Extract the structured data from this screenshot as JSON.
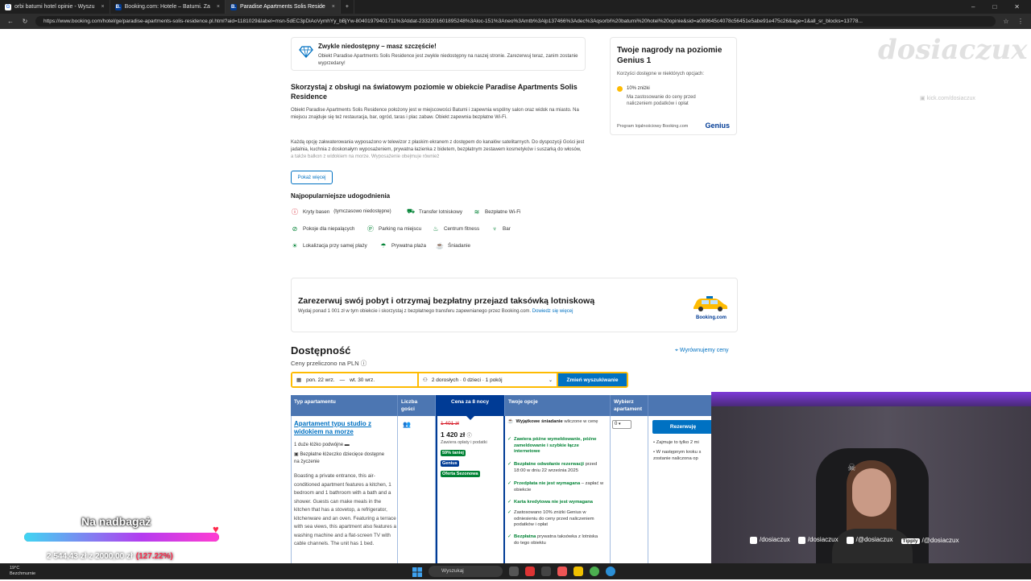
{
  "browser": {
    "tabs": [
      {
        "title": "orbi batumi hotel opinie - Wyszu",
        "fav": "G"
      },
      {
        "title": "Booking.com: Hotele – Batumi. Za",
        "fav": "B."
      },
      {
        "title": "Paradise Apartments Solis Reside",
        "fav": "B."
      }
    ],
    "url": "https://www.booking.com/hotel/ge/paradise-apartments-solis-residence.pl.html?aid=1181029&label=msn-5dEC3pDiAoVymhYy_bBjYw-80401979401711%3Atidat-2332201601895248%3Aloc-151%3Aneo%3Amtb%3Alp137466%3Adec%3Aqsorbi%20batumi%20hotel%20opinie&sid=a089645c4078c56451e5abe91e475c26&age=1&all_sr_blocks=13778..."
  },
  "notice": {
    "title": "Zwykle niedostępny – masz szczęście!",
    "text": "Obiekt Paradise Apartments Solis Residence jest zwykle niedostępny na naszej stronie. Zarezerwuj teraz, zanim zostanie wyprzedany!"
  },
  "genius": {
    "title": "Twoje nagrody na poziomie Genius 1",
    "subtitle": "Korzyści dostępne w niektórych opcjach:",
    "benefit": "10% zniżki",
    "benefit_note": "Ma zastosowanie do ceny przed naliczeniem podatków i opłat",
    "program": "Program lojalnościowy Booking.com",
    "logo": "Genius"
  },
  "description": {
    "title": "Skorzystaj z obsługi na światowym poziomie w obiekcie Paradise Apartments Solis Residence",
    "p1": "Obiekt Paradise Apartments Solis Residence położony jest w miejscowości Batumi i zapewnia wspólny salon oraz widok na miasto. Na miejscu znajduje się też restauracja, bar, ogród, taras i plac zabaw. Obiekt zapewnia bezpłatne Wi-Fi.",
    "p2": "Każdą opcję zakwaterowania wyposażono w telewizor z płaskim ekranem z dostępem do kanałów satelitarnych. Do dyspozycji Gości jest jadalnia, kuchnia z doskonałym wyposażeniem, prywatna łazienka z bidetem, bezpłatnym zestawem kosmetyków i suszarką do włosów, a także balkon z widokiem na morze. Wyposażenie obejmuje również",
    "more_button": "Pokaż więcej"
  },
  "facilities": {
    "title": "Najpopularniejsze udogodnienia",
    "items": [
      {
        "label": "Kryty basen",
        "note": "(tymczasowo niedostępne)",
        "icon": "alert-icon"
      },
      {
        "label": "Transfer lotniskowy",
        "icon": "shuttle-icon"
      },
      {
        "label": "Bezpłatne Wi-Fi",
        "icon": "wifi-icon"
      },
      {
        "label": "Pokoje dla niepalących",
        "icon": "no-smoking-icon"
      },
      {
        "label": "Parking na miejscu",
        "icon": "parking-icon"
      },
      {
        "label": "Centrum fitness",
        "icon": "fitness-icon"
      },
      {
        "label": "Bar",
        "icon": "bar-icon"
      },
      {
        "label": "Lokalizacja przy samej plaży",
        "icon": "beach-icon"
      },
      {
        "label": "Prywatna plaża",
        "icon": "beach-umbrella-icon"
      },
      {
        "label": "Śniadanie",
        "icon": "breakfast-icon"
      }
    ]
  },
  "taxi": {
    "title": "Zarezerwuj swój pobyt i otrzymaj bezpłatny przejazd taksówką lotniskową",
    "text": "Wydaj ponad 1 001 zł w tym obiekcie i skorzystaj z bezpłatnego transferu zapewnianego przez Booking.com.",
    "link": "Dowiedz się więcej",
    "brand": "Booking.com"
  },
  "availability": {
    "title": "Dostępność",
    "subtitle": "Ceny przeliczono na PLN",
    "price_match": "Wyrównujemy ceny",
    "check_in": "pon. 22 wrz.",
    "dash": "—",
    "check_out": "wt. 30 wrz.",
    "guests": "2 dorosłych · 0 dzieci · 1 pokój",
    "search_button": "Zmień wyszukiwanie"
  },
  "table": {
    "headers": [
      "Typ apartamentu",
      "Liczba gości",
      "Cena za 8 nocy",
      "Twoje opcje",
      "Wybierz apartament"
    ],
    "room": {
      "name": "Apartament typu studio z widokiem na morze",
      "bed": "1 duże łóżko podwójne",
      "crib": "Bezpłatne łóżeczko dziecięce dostępne na życzenie",
      "desc": "Boasting a private entrance, this air-conditioned apartment features a kitchen, 1 bedroom and 1 bathroom with a bath and a shower. Guests can make meals in the kitchen that has a stovetop, a refrigerator, kitchenware and an oven. Featuring a terrace with sea views, this apartment also features a washing machine and a flat-screen TV with cable channels. The unit has 1 bed."
    },
    "price": {
      "old": "1 401 zł",
      "new": "1 420 zł",
      "tax": "Zawiera opłaty i podatki",
      "badge_discount": "59% taniej",
      "badge_genius": "Genius",
      "badge_season": "Oferta Sezonowa"
    },
    "options": [
      {
        "bold": "Wyjątkowe śniadanie",
        "rest": " wliczone w cenę"
      },
      {
        "bold": "Zawiera późne wymeldowanie, późne zameldowanie i szybkie łącze internetowe",
        "rest": ""
      },
      {
        "bold": "Bezpłatne odwołanie rezerwacji",
        "rest": " przed 18:00 w dniu 22 września 2025"
      },
      {
        "bold": "Przedpłata nie jest wymagana",
        "rest": " – zapłać w obiekcie"
      },
      {
        "bold": "Karta kredytowa nie jest wymagana",
        "rest": ""
      },
      {
        "bold": "",
        "rest": "Zastosowano 10% zniżki Genius w odniesieniu do ceny przed naliczeniem podatków i opłat"
      },
      {
        "bold": "Bezpłatna",
        "rest": " prywatna taksówka z lotniska do tego obiektu"
      }
    ],
    "select_value": "0",
    "reserve_button": "Rezerwuję",
    "notes": [
      "Zajmuje to tylko 2 mi",
      "W następnym kroku s zostanie naliczona op"
    ]
  },
  "watermark": {
    "logo": "dosiaczux",
    "kick": "kick.com/dosiaczux"
  },
  "socials": [
    "/dosiaczux",
    "/dosiaczux",
    "/@dosiaczux",
    "/@dosiaczux"
  ],
  "socials_tippy": "Tipply",
  "goal": {
    "title": "Na nadbagaż",
    "amount": "2 544,43 zł z 2000,00 zł",
    "percent": "(127.22%)",
    "progress": 1.0
  },
  "taskbar": {
    "temp": "19°C",
    "weather": "Bezchmurnie",
    "search": "Wyszukaj"
  },
  "colors": {
    "brand": "#003b95",
    "accent": "#0071c2",
    "yellow": "#febb02",
    "green": "#008234",
    "red": "#d4111e"
  }
}
